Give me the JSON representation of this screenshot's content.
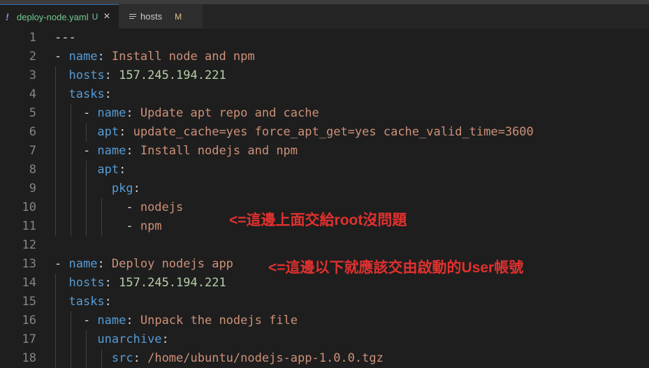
{
  "tabs": [
    {
      "icon": "!",
      "label": "deploy-node.yaml",
      "badge": "U",
      "close": "×"
    },
    {
      "icon": "list-icon",
      "label": "hosts",
      "badge": "M"
    }
  ],
  "lines": [
    {
      "num": "1",
      "indent": 0,
      "tokens": [
        {
          "t": "---",
          "c": "p"
        }
      ]
    },
    {
      "num": "2",
      "indent": 0,
      "tokens": [
        {
          "t": "- ",
          "c": "p"
        },
        {
          "t": "name",
          "c": "k"
        },
        {
          "t": ": ",
          "c": "p"
        },
        {
          "t": "Install node and npm",
          "c": "s"
        }
      ]
    },
    {
      "num": "3",
      "indent": 1,
      "tokens": [
        {
          "t": "  ",
          "c": "p"
        },
        {
          "t": "hosts",
          "c": "k"
        },
        {
          "t": ": ",
          "c": "p"
        },
        {
          "t": "157.245.194.221",
          "c": "n"
        }
      ]
    },
    {
      "num": "4",
      "indent": 1,
      "tokens": [
        {
          "t": "  ",
          "c": "p"
        },
        {
          "t": "tasks",
          "c": "k"
        },
        {
          "t": ":",
          "c": "p"
        }
      ]
    },
    {
      "num": "5",
      "indent": 2,
      "tokens": [
        {
          "t": "    - ",
          "c": "p"
        },
        {
          "t": "name",
          "c": "k"
        },
        {
          "t": ": ",
          "c": "p"
        },
        {
          "t": "Update apt repo and cache",
          "c": "s"
        }
      ]
    },
    {
      "num": "6",
      "indent": 3,
      "tokens": [
        {
          "t": "      ",
          "c": "p"
        },
        {
          "t": "apt",
          "c": "k"
        },
        {
          "t": ": ",
          "c": "p"
        },
        {
          "t": "update_cache=yes force_apt_get=yes cache_valid_time=3600",
          "c": "s"
        }
      ]
    },
    {
      "num": "7",
      "indent": 2,
      "tokens": [
        {
          "t": "    - ",
          "c": "p"
        },
        {
          "t": "name",
          "c": "k"
        },
        {
          "t": ": ",
          "c": "p"
        },
        {
          "t": "Install nodejs and npm",
          "c": "s"
        }
      ]
    },
    {
      "num": "8",
      "indent": 3,
      "tokens": [
        {
          "t": "      ",
          "c": "p"
        },
        {
          "t": "apt",
          "c": "k"
        },
        {
          "t": ":",
          "c": "p"
        }
      ]
    },
    {
      "num": "9",
      "indent": 3,
      "tokens": [
        {
          "t": "        ",
          "c": "p"
        },
        {
          "t": "pkg",
          "c": "k"
        },
        {
          "t": ":",
          "c": "p"
        }
      ]
    },
    {
      "num": "10",
      "indent": 4,
      "tokens": [
        {
          "t": "          - ",
          "c": "p"
        },
        {
          "t": "nodejs",
          "c": "s"
        }
      ]
    },
    {
      "num": "11",
      "indent": 4,
      "tokens": [
        {
          "t": "          - ",
          "c": "p"
        },
        {
          "t": "npm",
          "c": "s"
        }
      ]
    },
    {
      "num": "12",
      "indent": 0,
      "tokens": []
    },
    {
      "num": "13",
      "indent": 0,
      "tokens": [
        {
          "t": "- ",
          "c": "p"
        },
        {
          "t": "name",
          "c": "k"
        },
        {
          "t": ": ",
          "c": "p"
        },
        {
          "t": "Deploy nodejs app",
          "c": "s"
        }
      ]
    },
    {
      "num": "14",
      "indent": 1,
      "tokens": [
        {
          "t": "  ",
          "c": "p"
        },
        {
          "t": "hosts",
          "c": "k"
        },
        {
          "t": ": ",
          "c": "p"
        },
        {
          "t": "157.245.194.221",
          "c": "n"
        }
      ]
    },
    {
      "num": "15",
      "indent": 1,
      "tokens": [
        {
          "t": "  ",
          "c": "p"
        },
        {
          "t": "tasks",
          "c": "k"
        },
        {
          "t": ":",
          "c": "p"
        }
      ]
    },
    {
      "num": "16",
      "indent": 2,
      "tokens": [
        {
          "t": "    - ",
          "c": "p"
        },
        {
          "t": "name",
          "c": "k"
        },
        {
          "t": ": ",
          "c": "p"
        },
        {
          "t": "Unpack the nodejs file",
          "c": "s"
        }
      ]
    },
    {
      "num": "17",
      "indent": 3,
      "tokens": [
        {
          "t": "      ",
          "c": "p"
        },
        {
          "t": "unarchive",
          "c": "k"
        },
        {
          "t": ":",
          "c": "p"
        }
      ]
    },
    {
      "num": "18",
      "indent": 4,
      "tokens": [
        {
          "t": "        ",
          "c": "p"
        },
        {
          "t": "src",
          "c": "k"
        },
        {
          "t": ": ",
          "c": "p"
        },
        {
          "t": "/home/ubuntu/nodejs-app-1.0.0.tgz",
          "c": "s"
        }
      ]
    }
  ],
  "annotations": [
    "<=這邊上面交給root沒問題",
    "<=這邊以下就應該交由啟動的User帳號"
  ],
  "colors": {
    "keyword": "#569cd6",
    "string": "#ce9178",
    "number": "#b5cea8",
    "annotation": "#e0312f",
    "untracked": "#73c991",
    "modified": "#e2c08d"
  }
}
